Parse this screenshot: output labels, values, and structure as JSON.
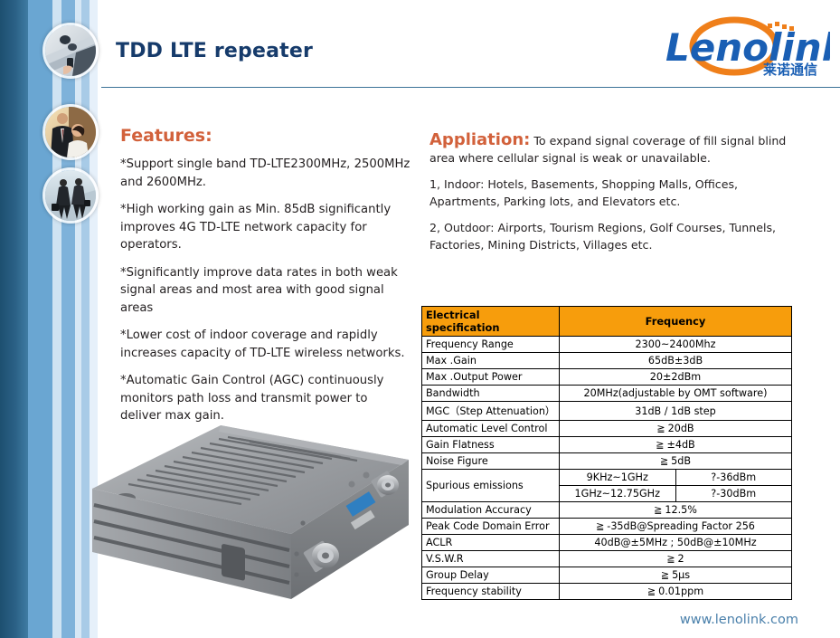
{
  "header": {
    "title": "TDD LTE repeater",
    "logo": {
      "wordmark": "Lenolink",
      "chinese": "莱诺通信"
    }
  },
  "sidebar": {
    "photos": [
      {
        "name": "photo-businessman-phone",
        "alt": "Businessman using mobile phone"
      },
      {
        "name": "photo-business-pair",
        "alt": "Two business colleagues"
      },
      {
        "name": "photo-commuters",
        "alt": "Business people walking"
      }
    ]
  },
  "features": {
    "heading": "Features:",
    "items": [
      "*Support single band TD-LTE2300MHz, 2500MHz and 2600MHz.",
      "*High working gain as Min. 85dB significantly improves 4G TD-LTE network capacity for operators.",
      "*Significantly improve data rates in both weak signal areas and most area with good signal areas",
      "*Lower cost of indoor coverage and rapidly increases capacity of TD-LTE wireless networks.",
      "*Automatic Gain Control (AGC) continuously monitors path loss and transmit power to deliver max gain."
    ]
  },
  "application": {
    "heading": "Appliation:",
    "lead": " To expand signal coverage of fill signal blind area where cellular signal is weak or unavailable.",
    "items": [
      "1, Indoor: Hotels, Basements, Shopping Malls, Offices, Apartments, Parking lots, and Elevators etc.",
      "2, Outdoor: Airports, Tourism Regions, Golf Courses, Tunnels, Factories, Mining Districts, Villages etc."
    ]
  },
  "spec_table": {
    "headers": [
      "Electrical specification",
      "Frequency"
    ],
    "rows": [
      {
        "label": "Frequency Range",
        "value": "2300~2400Mhz"
      },
      {
        "label": "Max .Gain",
        "value": "65dB±3dB"
      },
      {
        "label": "Max .Output Power",
        "value": "20±2dBm"
      },
      {
        "label": "Bandwidth",
        "value": "20MHz(adjustable by OMT software)"
      },
      {
        "label": "MGC（Step Attenuation）",
        "value": "31dB / 1dB step"
      },
      {
        "label": "Automatic Level Control",
        "value": "20dB",
        "ge": true
      },
      {
        "label": "Gain Flatness",
        "value": "±4dB",
        "ge": true
      },
      {
        "label": "Noise Figure",
        "value": "5dB",
        "ge": true
      },
      {
        "label": "Spurious emissions",
        "sub": [
          {
            "range": "9KHz~1GHz",
            "level": "?-36dBm"
          },
          {
            "range": "1GHz~12.75GHz",
            "level": "?-30dBm"
          }
        ]
      },
      {
        "label": "Modulation Accuracy",
        "value": "12.5%",
        "ge": true
      },
      {
        "label": "Peak Code Domain Error",
        "value": "-35dB@Spreading Factor 256",
        "ge": true
      },
      {
        "label": "ACLR",
        "value": "40dB@±5MHz   ; 50dB@±10MHz"
      },
      {
        "label": "V.S.W.R",
        "value": "2",
        "ge": true
      },
      {
        "label": "Group Delay",
        "value": "5μs",
        "ge": true
      },
      {
        "label": "Frequency stability",
        "value": "0.01ppm",
        "ge": true
      }
    ]
  },
  "product": {
    "name": "tdd-lte-repeater-unit",
    "alt": "Silver aluminium heat-sink repeater unit with N-type connectors"
  },
  "footer": {
    "url": "www.lenolink.com"
  },
  "colors": {
    "title_blue": "#163b6b",
    "accent_orange": "#d2613b",
    "table_header_orange": "#f79d0c",
    "rule_blue": "#3b7397",
    "footer_blue": "#4a80ab",
    "sidebar_dark_blue": "#1d4f70",
    "logo_blue": "#1a5fb4",
    "logo_orange": "#ef7f1a"
  }
}
